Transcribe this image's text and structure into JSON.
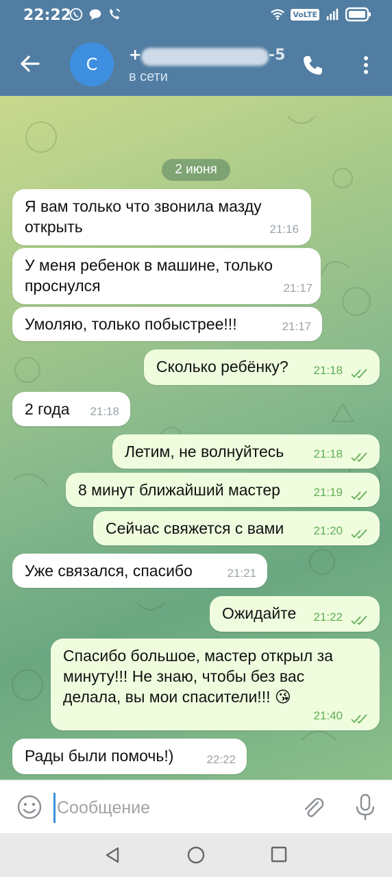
{
  "status_bar": {
    "time": "22:22",
    "volte_label": "VoLTE",
    "icons": [
      "viber-icon",
      "chat-icon",
      "wifi-call-icon",
      "wifi-icon",
      "volte-icon",
      "signal-icon",
      "battery-icon"
    ]
  },
  "header": {
    "avatar_letter": "С",
    "contact_name": "+",
    "contact_name_suffix": "-5",
    "contact_status": "в сети",
    "icons": [
      "back-arrow-icon",
      "phone-icon",
      "more-vertical-icon"
    ]
  },
  "chat": {
    "date": "2 июня",
    "messages": [
      {
        "direction": "in",
        "text": "Я вам только что звонила мазду открыть",
        "time": "21:16"
      },
      {
        "direction": "in",
        "text": "У меня ребенок в машине, только проснулся",
        "time": "21:17"
      },
      {
        "direction": "in",
        "text": "Умоляю, только побыстрее!!!",
        "time": "21:17"
      },
      {
        "direction": "out",
        "text": "Сколько ребёнку?",
        "time": "21:18",
        "read": true
      },
      {
        "direction": "in",
        "text": "2 года",
        "time": "21:18"
      },
      {
        "direction": "out",
        "text": "Летим, не волнуйтесь",
        "time": "21:18",
        "read": true
      },
      {
        "direction": "out",
        "text": "8 минут ближайший мастер",
        "time": "21:19",
        "read": true
      },
      {
        "direction": "out",
        "text": "Сейчас свяжется с вами",
        "time": "21:20",
        "read": true
      },
      {
        "direction": "in",
        "text": "Уже связался, спасибо",
        "time": "21:21"
      },
      {
        "direction": "out",
        "text": "Ожидайте",
        "time": "21:22",
        "read": true
      },
      {
        "direction": "out",
        "text": "Спасибо большое, мастер открыл за минуту!!! Не знаю, чтобы без вас делала, вы мои спасители!!!",
        "emoji": "😘",
        "time": "21:40",
        "read": true
      },
      {
        "direction": "in",
        "text": "Рады были помочь!)",
        "time": "22:22"
      }
    ]
  },
  "input": {
    "placeholder": "Сообщение",
    "icons": [
      "emoji-icon",
      "attach-icon",
      "mic-icon"
    ]
  },
  "nav": {
    "icons": [
      "nav-back-icon",
      "nav-home-icon",
      "nav-recent-icon"
    ]
  },
  "colors": {
    "header": "#517da2",
    "incoming_bubble": "#ffffff",
    "outgoing_bubble": "#effdde",
    "outgoing_time": "#5fae55"
  }
}
